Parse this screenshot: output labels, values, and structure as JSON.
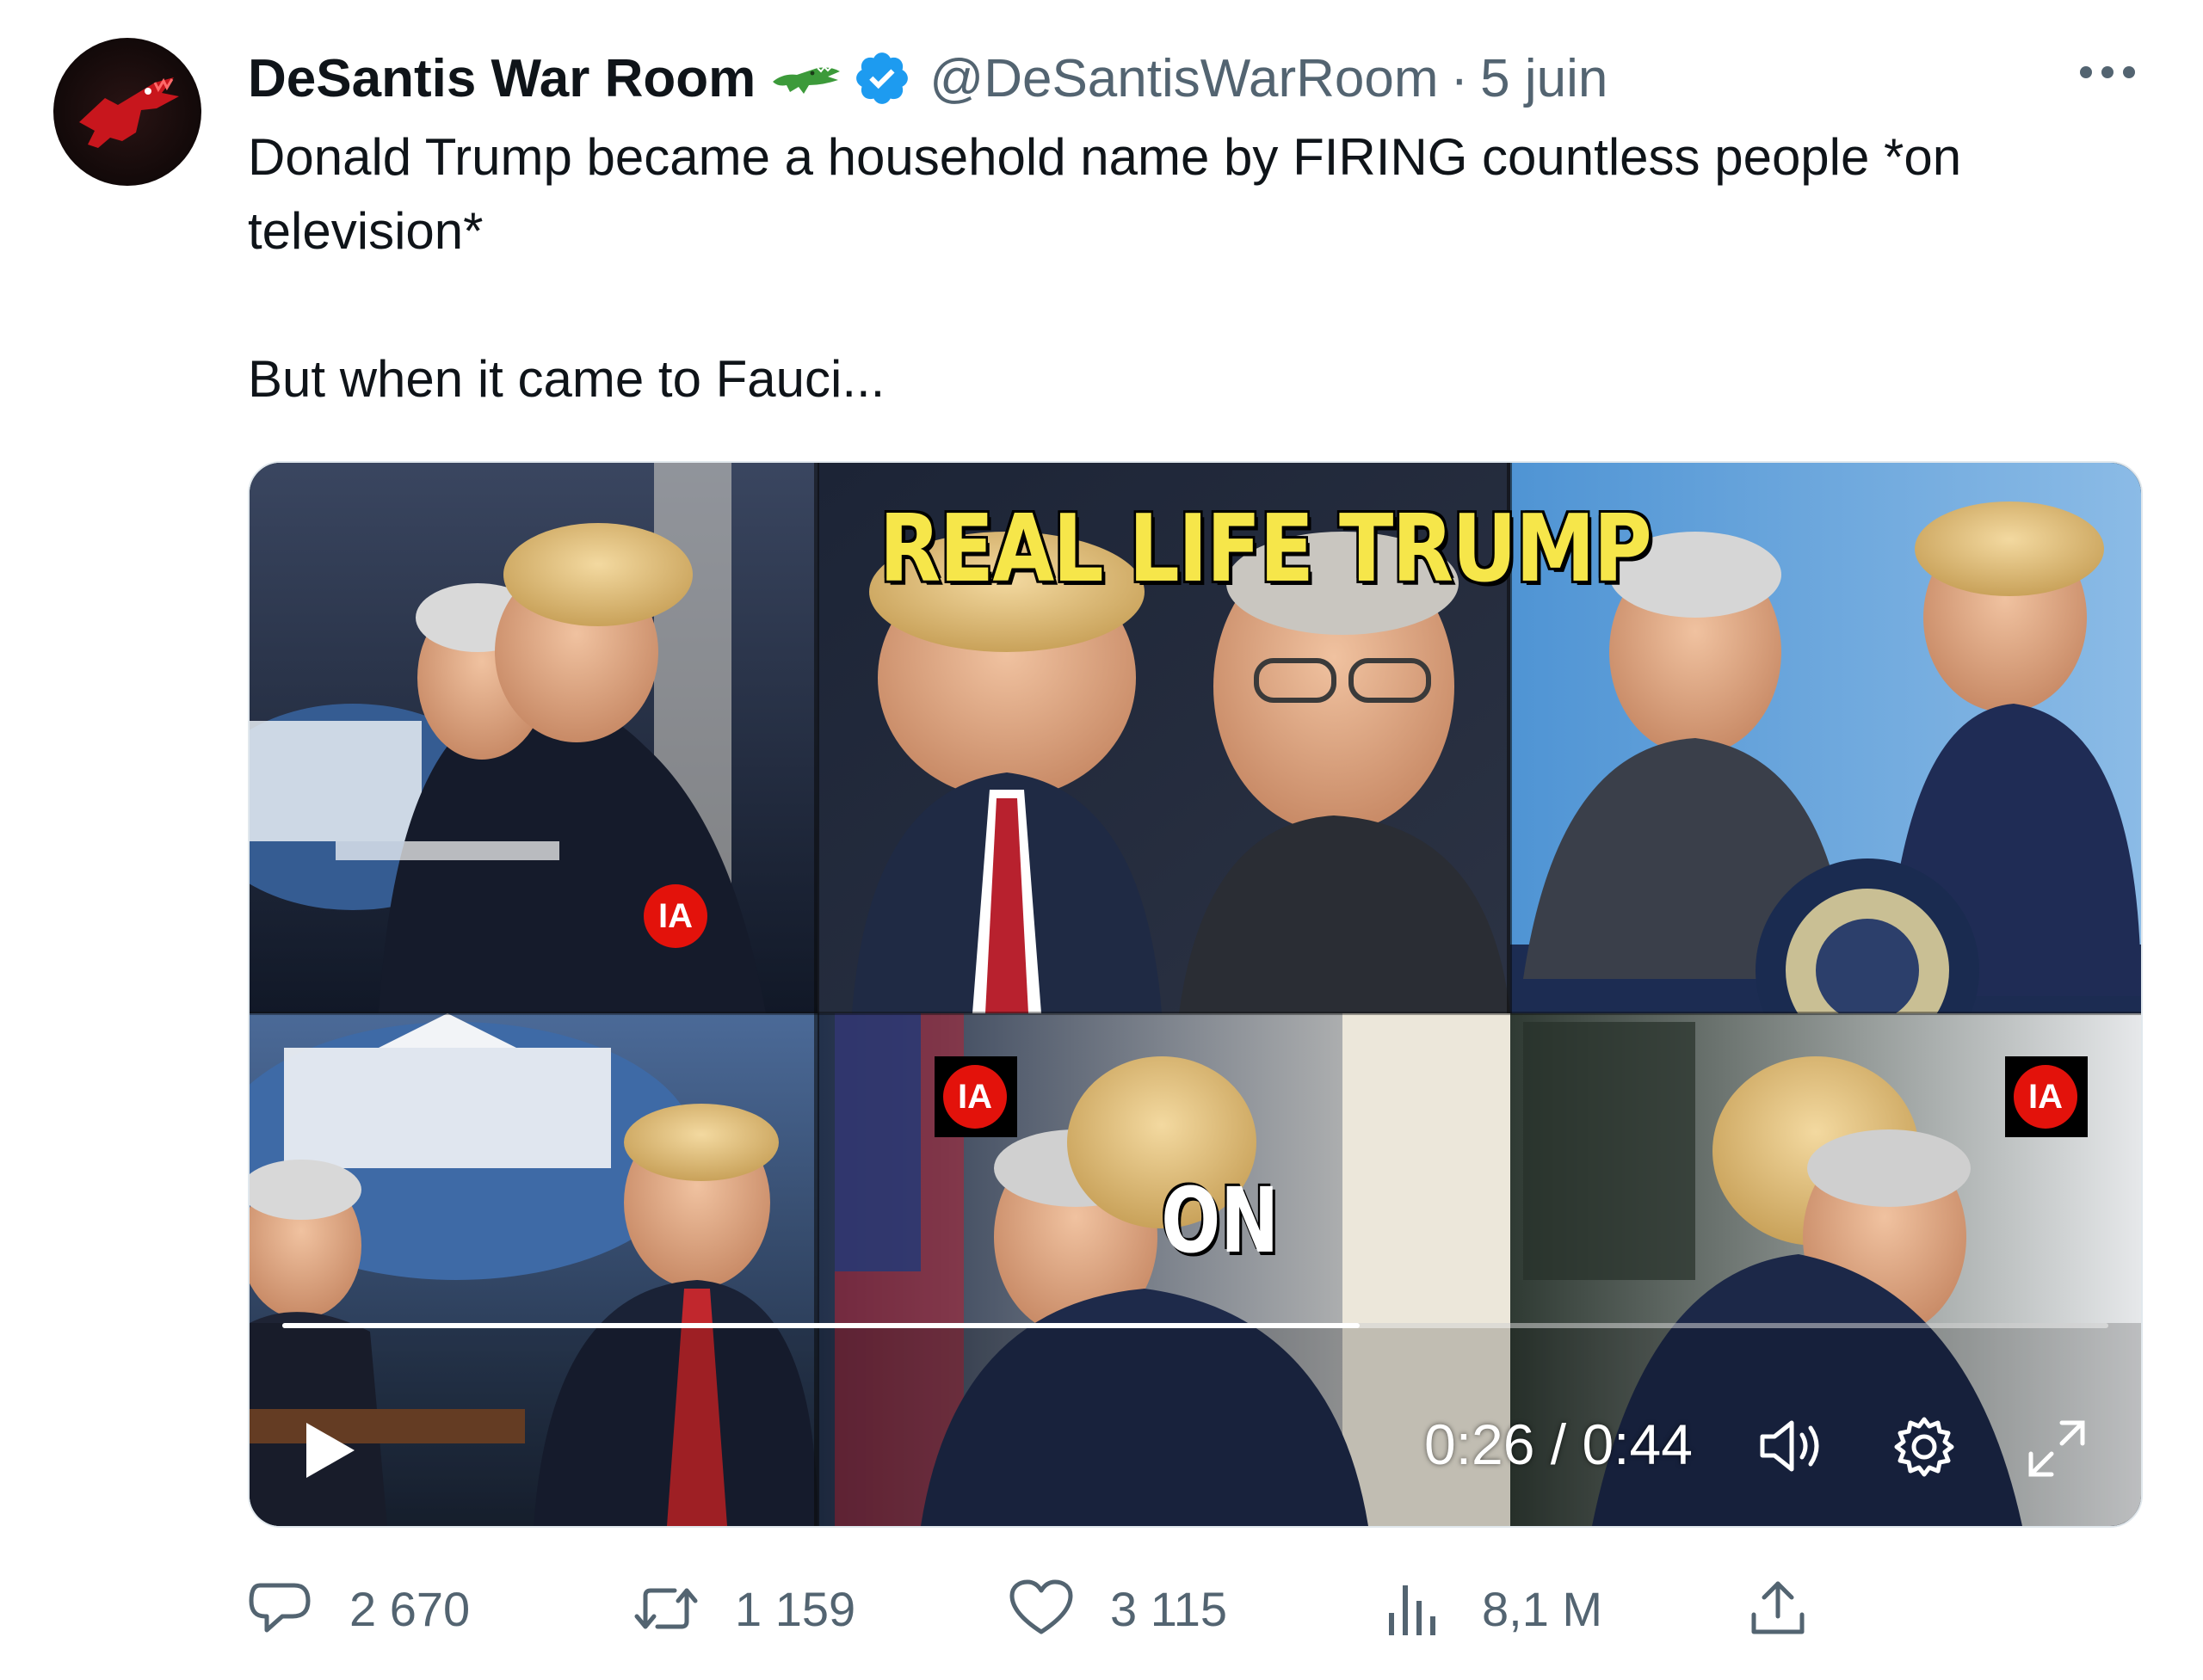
{
  "author": {
    "display_name": "DeSantis War Room",
    "handle": "@DeSantisWarRoom",
    "date": "5 juin",
    "separator": "·",
    "verified": true
  },
  "tweet": {
    "line1": "Donald Trump became a household name by FIRING countless people *on television*",
    "line2": "But when it came to Fauci..."
  },
  "video": {
    "headline": "REAL LIFE TRUMP",
    "caption": "ON",
    "ai_badge": "IA",
    "time": "0:26 / 0:44",
    "progress": 0.59
  },
  "metrics": {
    "replies": "2 670",
    "reposts": "1 159",
    "likes": "3 115",
    "views": "8,1 M"
  },
  "icons": {
    "reply": "speech-bubble-icon",
    "repost": "repost-arrows-icon",
    "like": "heart-icon",
    "views": "bar-chart-icon",
    "share": "share-upload-icon"
  },
  "colors": {
    "verified_blue": "#1d9bf0",
    "text_primary": "#0f1419",
    "text_secondary": "#536471",
    "headline_yellow": "#f6e64a",
    "ai_badge_red": "#e3120b"
  }
}
